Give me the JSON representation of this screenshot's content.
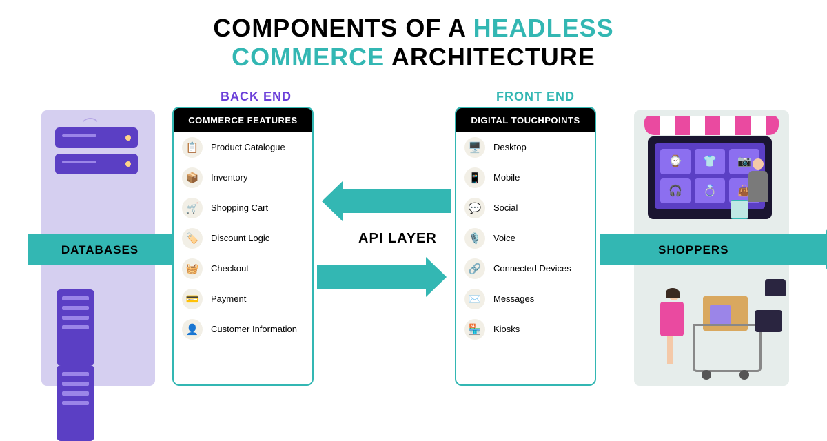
{
  "title": {
    "p1": "COMPONENTS OF A ",
    "p2": "HEADLESS",
    "p3": "COMMERCE",
    "p4": " ARCHITECTURE"
  },
  "labels": {
    "backend": "BACK END",
    "frontend": "FRONT END",
    "databases": "DATABASES",
    "api": "API LAYER",
    "shoppers": "SHOPPERS"
  },
  "panels": {
    "commerce_header": "COMMERCE FEATURES",
    "touchpoints_header": "DIGITAL TOUCHPOINTS"
  },
  "commerce_features": [
    {
      "icon": "📋",
      "label": "Product Catalogue"
    },
    {
      "icon": "📦",
      "label": "Inventory"
    },
    {
      "icon": "🛒",
      "label": "Shopping Cart"
    },
    {
      "icon": "🏷️",
      "label": "Discount Logic"
    },
    {
      "icon": "🧺",
      "label": "Checkout"
    },
    {
      "icon": "💳",
      "label": "Payment"
    },
    {
      "icon": "👤",
      "label": "Customer Information"
    }
  ],
  "touchpoints": [
    {
      "icon": "🖥️",
      "label": "Desktop"
    },
    {
      "icon": "📱",
      "label": "Mobile"
    },
    {
      "icon": "💬",
      "label": "Social"
    },
    {
      "icon": "🎙️",
      "label": "Voice"
    },
    {
      "icon": "🔗",
      "label": "Connected Devices"
    },
    {
      "icon": "✉️",
      "label": "Messages"
    },
    {
      "icon": "🏪",
      "label": "Kiosks"
    }
  ],
  "screen_icons": [
    "⌚",
    "👕",
    "📷",
    "🎧",
    "💍",
    "👜"
  ]
}
